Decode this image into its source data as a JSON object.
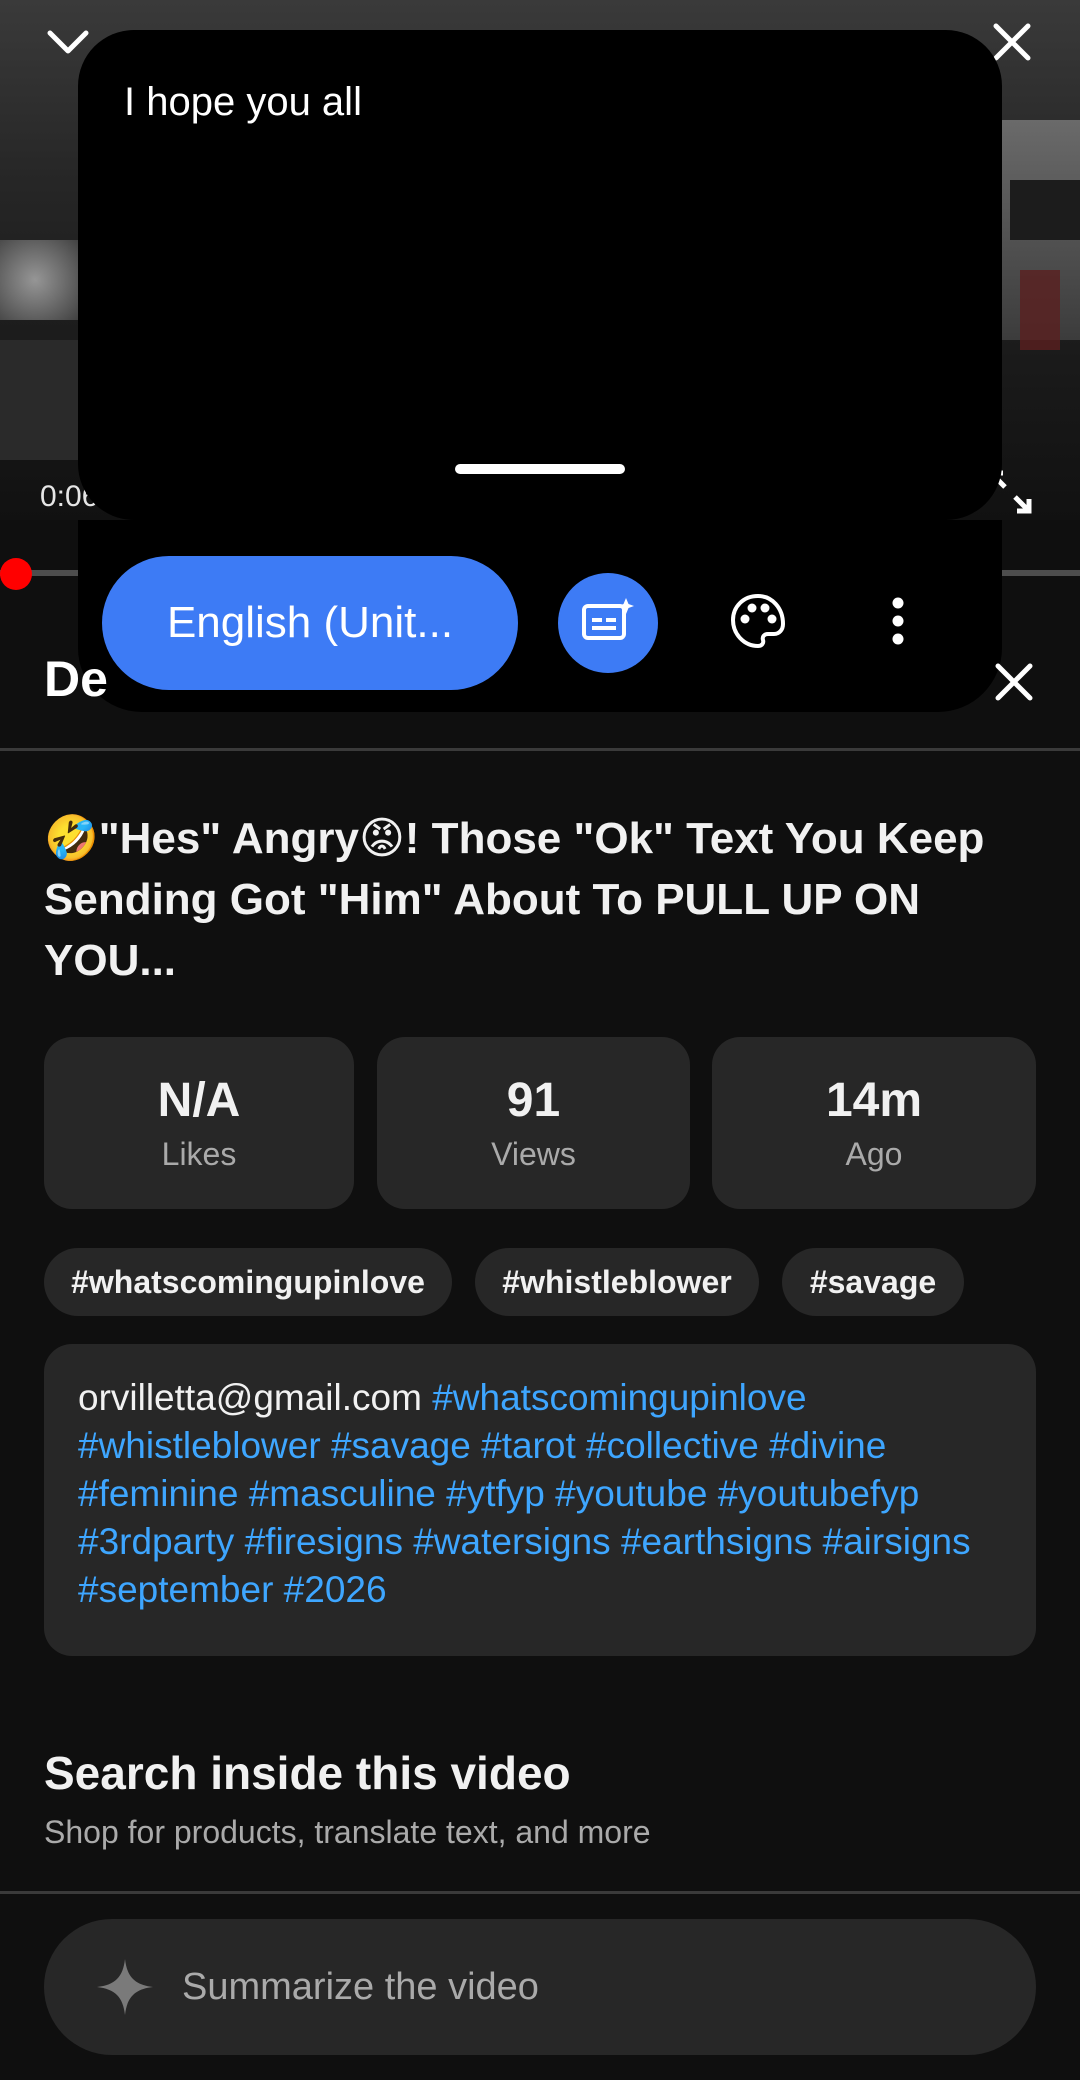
{
  "player": {
    "time": "0:06",
    "caption_text": "I hope you all",
    "caption_language": "English (Unit...",
    "progress": 0.01
  },
  "description": {
    "header_title": "De",
    "title": "🤣\"Hes\" Angry😡! Those \"Ok\" Text You Keep Sending Got \"Him\" About To PULL UP ON YOU...",
    "stats": {
      "likes_value": "N/A",
      "likes_label": "Likes",
      "views_value": "91",
      "views_label": "Views",
      "ago_value": "14m",
      "ago_label": "Ago"
    },
    "chips": [
      "#whatscomingupinlove",
      "#whistleblower",
      "#savage"
    ],
    "body_email": "orvilletta@gmail.com",
    "body_tags": [
      "#whatscomingupinlove",
      "#whistleblower",
      "#savage",
      "#tarot",
      "#collective",
      "#divine",
      "#feminine",
      "#masculine",
      "#ytfyp",
      "#youtube",
      "#youtubefyp",
      "#3rdparty",
      "#firesigns",
      "#watersigns",
      "#earthsigns",
      "#airsigns",
      "#september",
      "#2026"
    ]
  },
  "search_inside": {
    "title": "Search inside this video",
    "subtitle": "Shop for products, translate text, and more"
  },
  "summarize": {
    "placeholder": "Summarize the video"
  },
  "colors": {
    "accent_blue": "#3d7bf5",
    "hashtag_blue": "#3ea6ff",
    "progress_red": "#ff0000",
    "surface": "#272727",
    "background": "#0f0f0f"
  },
  "icons": {
    "collapse": "chevron-down-icon",
    "close": "close-icon",
    "fullscreen": "fullscreen-icon",
    "ai_captions": "ai-captions-icon",
    "palette": "palette-icon",
    "more": "more-vertical-icon",
    "sparkle": "sparkle-icon"
  }
}
